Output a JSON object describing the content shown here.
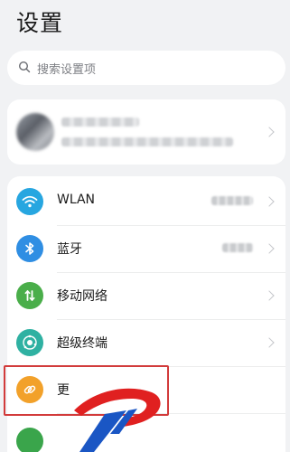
{
  "header": {
    "title": "设置"
  },
  "search": {
    "placeholder": "搜索设置项",
    "icon": "search-icon"
  },
  "account": {
    "icon": "avatar"
  },
  "list": {
    "items": [
      {
        "label": "WLAN",
        "icon": "wifi-icon",
        "color": "#27a6e0"
      },
      {
        "label": "蓝牙",
        "icon": "bluetooth-icon",
        "color": "#2f8ee3"
      },
      {
        "label": "移动网络",
        "icon": "mobile-data-icon",
        "color": "#4aae4a"
      },
      {
        "label": "超级终端",
        "icon": "super-device-icon",
        "color": "#2fb1a2"
      },
      {
        "label": "更",
        "icon": "link-icon",
        "color": "#f2a12a"
      }
    ]
  },
  "colors": {
    "highlight": "#d23b3b",
    "background": "#f1f2f4"
  }
}
